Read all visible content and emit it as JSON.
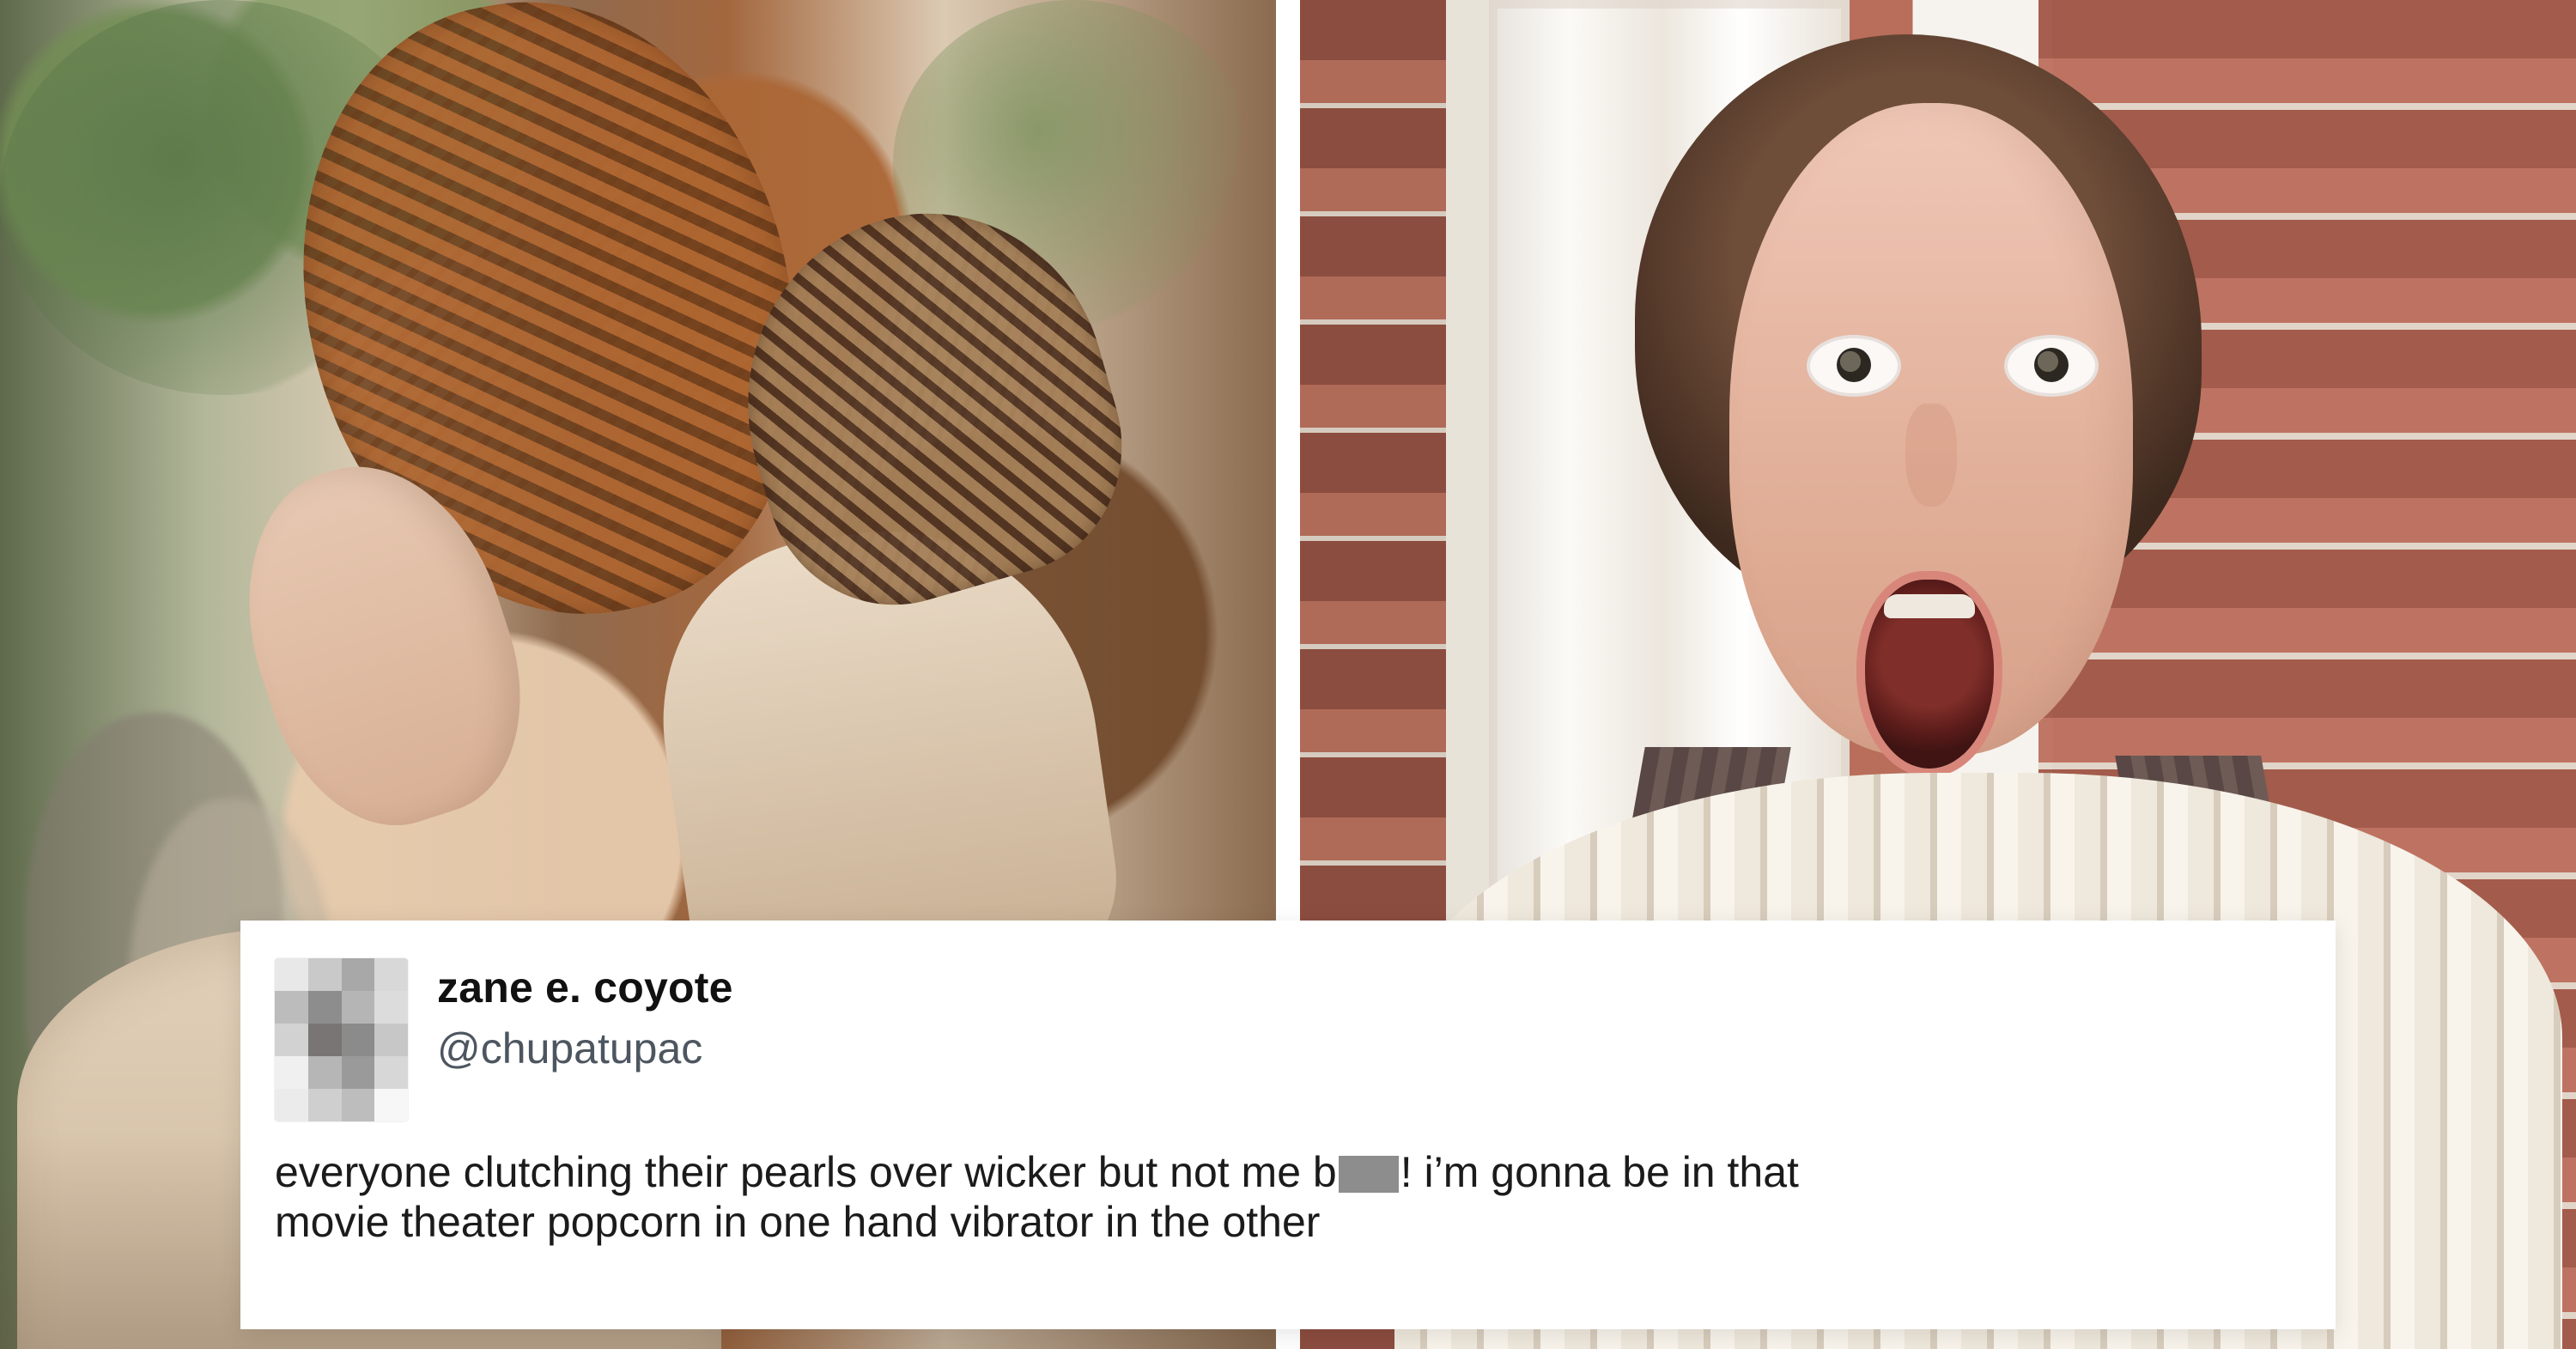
{
  "tweet": {
    "display_name": "zane e. coyote",
    "handle": "@chupatupac",
    "text_line_1_before_censor": "everyone clutching their pearls over wicker but not me b",
    "text_line_1_after_censor": "! i’m gonna be in that",
    "text_line_2": "movie theater popcorn in one hand vibrator in the other"
  },
  "icons": {
    "avatar": "pixelated-avatar"
  },
  "colors": {
    "card_background": "#ffffff",
    "name_text": "#111111",
    "handle_text": "#4d5660",
    "body_text": "#1b1b1b",
    "censor_fill": "#8d8d8d"
  }
}
